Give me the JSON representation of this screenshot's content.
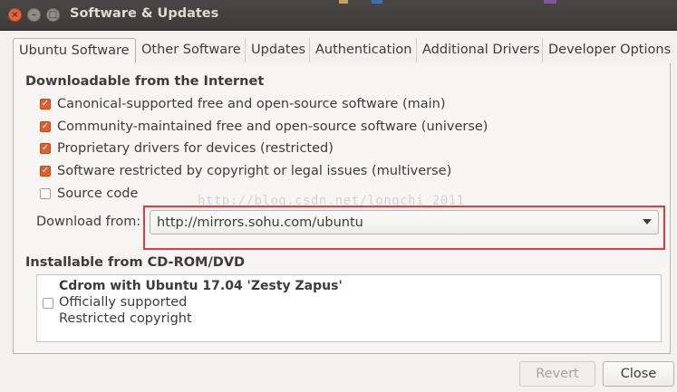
{
  "window": {
    "title": "Software & Updates",
    "close_glyph": "×",
    "min_glyph": "–",
    "max_glyph": "□"
  },
  "tabs": [
    {
      "label": "Ubuntu Software",
      "active": true
    },
    {
      "label": "Other Software",
      "active": false
    },
    {
      "label": "Updates",
      "active": false
    },
    {
      "label": "Authentication",
      "active": false
    },
    {
      "label": "Additional Drivers",
      "active": false
    },
    {
      "label": "Developer Options",
      "active": false
    }
  ],
  "downloadable": {
    "heading": "Downloadable from the Internet",
    "items": [
      {
        "label": "Canonical-supported free and open-source software (main)",
        "checked": true
      },
      {
        "label": "Community-maintained free and open-source software (universe)",
        "checked": true
      },
      {
        "label": "Proprietary drivers for devices (restricted)",
        "checked": true
      },
      {
        "label": "Software restricted by copyright or legal issues (multiverse)",
        "checked": true
      },
      {
        "label": "Source code",
        "checked": false
      }
    ],
    "download_from_label": "Download from:",
    "download_from_value": "http://mirrors.sohu.com/ubuntu"
  },
  "watermark": "http://blog.csdn.net/longchi_2011",
  "cdrom": {
    "heading": "Installable from CD-ROM/DVD",
    "title": "Cdrom with Ubuntu 17.04 'Zesty Zapus'",
    "line2": "Officially supported",
    "line3": "Restricted copyright",
    "checked": false
  },
  "buttons": {
    "revert": "Revert",
    "close": "Close"
  },
  "colors": {
    "titlebar": "#3c3b37",
    "accent_checkbox": "#e05e2b",
    "highlight_box": "#e03c3c",
    "window_bg": "#f2f1f0"
  }
}
